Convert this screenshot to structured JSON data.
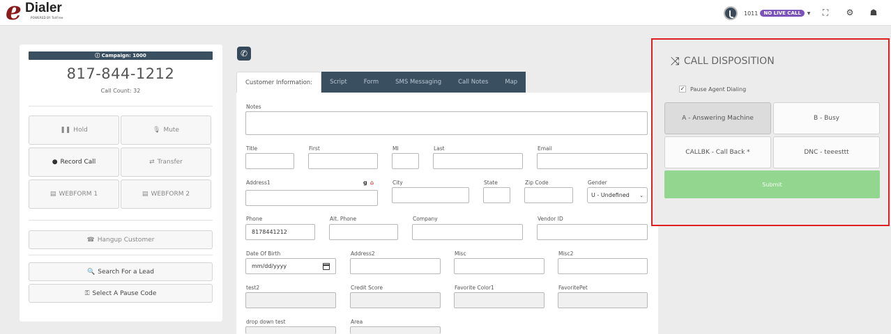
{
  "header": {
    "logo_letter": "e",
    "logo_text": "Dialer",
    "logo_tagline": "POWERED BY TollFree",
    "extension": "1011",
    "live_status": "NO LIVE CALL"
  },
  "left_panel": {
    "campaign": "Campaign: 1000",
    "phone_number": "817-844-1212",
    "call_count": "Call Count: 32",
    "buttons": {
      "hold": "Hold",
      "mute": "Mute",
      "record": "Record Call",
      "transfer": "Transfer",
      "webform1": "WEBFORM 1",
      "webform2": "WEBFORM 2",
      "hangup": "Hangup Customer",
      "search": "Search For a Lead",
      "pause_code": "Select A Pause Code"
    }
  },
  "tabs": [
    "Customer Information:",
    "Script",
    "Form",
    "SMS Messaging",
    "Call Notes",
    "Map"
  ],
  "form": {
    "labels": {
      "notes": "Notes",
      "title": "Title",
      "first": "First",
      "mi": "MI",
      "last": "Last",
      "email": "Email",
      "address1": "Address1",
      "city": "City",
      "state": "State",
      "zip": "Zip Code",
      "gender": "Gender",
      "phone": "Phone",
      "alt_phone": "Alt. Phone",
      "company": "Company",
      "vendor_id": "Vendor ID",
      "dob": "Date Of Birth",
      "address2": "Address2",
      "misc": "Misc",
      "misc2": "Misc2",
      "test2": "test2",
      "credit_score": "Credit Score",
      "favorite_color": "Favorite Color1",
      "favorite_pet": "FavoritePet",
      "dropdown_test": "drop down test",
      "area": "Area"
    },
    "values": {
      "phone": "8178441212",
      "gender": "U - Undefined",
      "dob_placeholder": "mm/dd/yyyy"
    }
  },
  "disposition": {
    "title": "CALL DISPOSITION",
    "pause_label": "Pause Agent Dialing",
    "pause_checked": true,
    "options": [
      "A - Answering Machine",
      "B - Busy",
      "CALLBK - Call Back *",
      "DNC - teeesttt"
    ],
    "selected": "A - Answering Machine",
    "submit": "Submit"
  },
  "colors": {
    "accent_dark": "#3a4f60",
    "badge": "#7b52b8",
    "submit": "#93d690",
    "highlight_border": "#e02020"
  }
}
